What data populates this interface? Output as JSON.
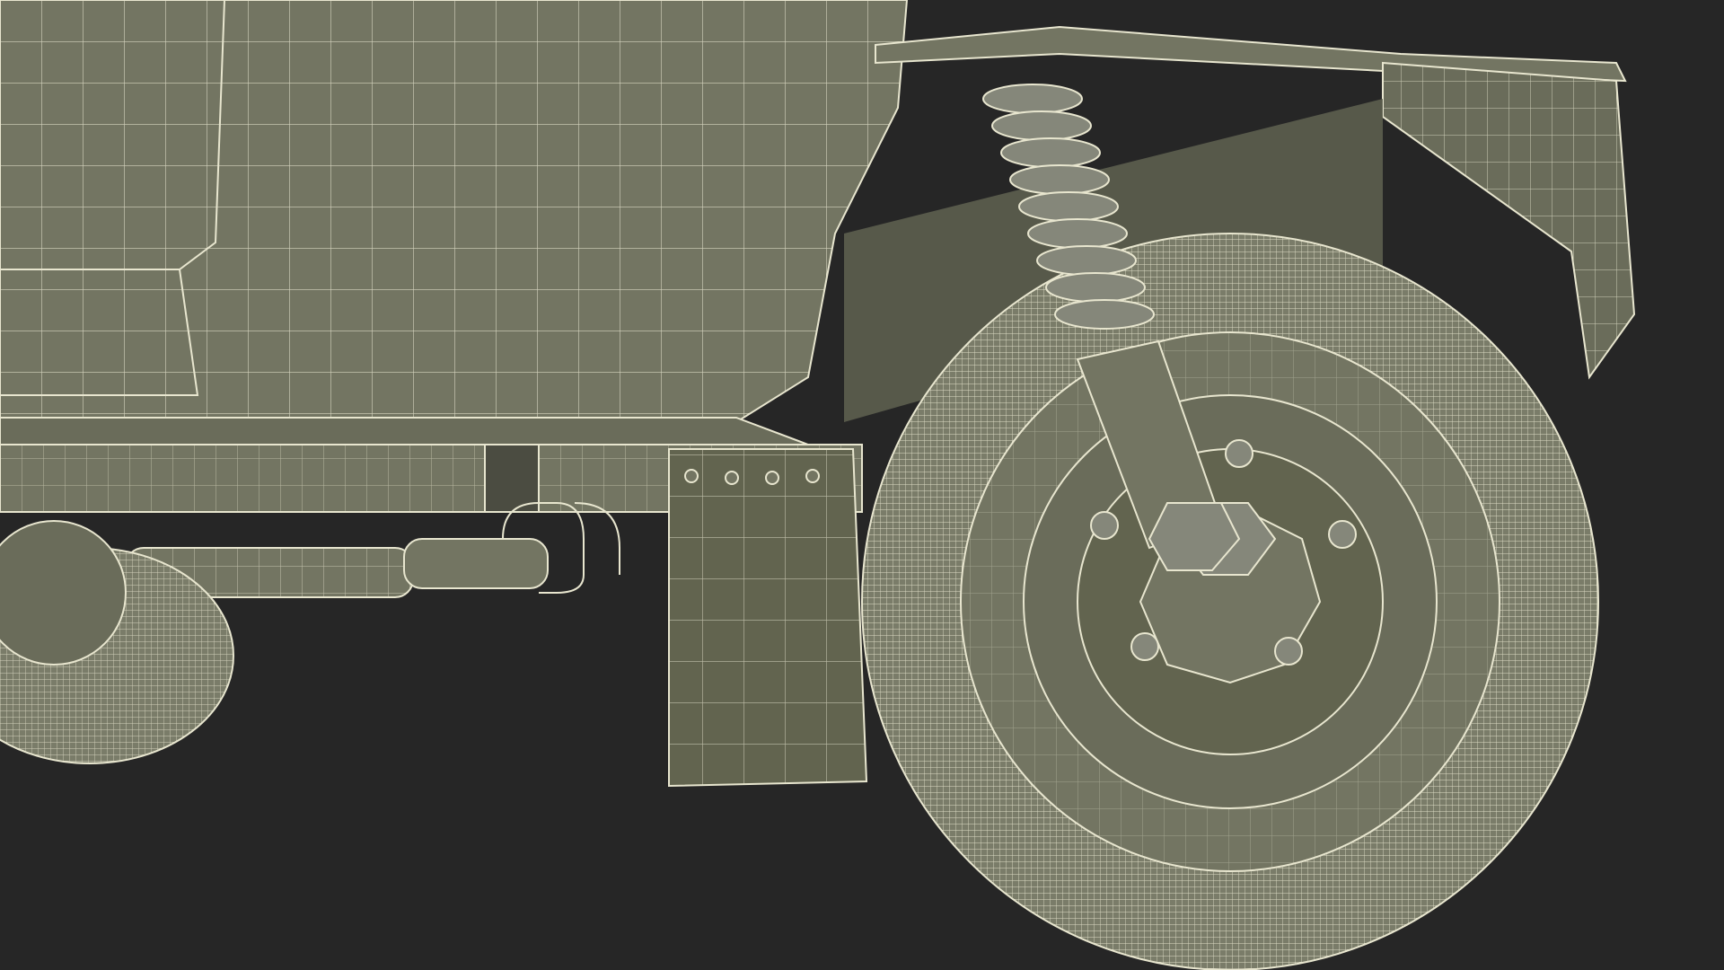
{
  "viewport": {
    "background": "#262626"
  },
  "model": {
    "body_color": "#737562",
    "body_shadow": "#5d5f4f",
    "panel_dark": "#4b4c41",
    "wire_color": "#e8e6cf",
    "tire_color": "#7a7c69"
  }
}
